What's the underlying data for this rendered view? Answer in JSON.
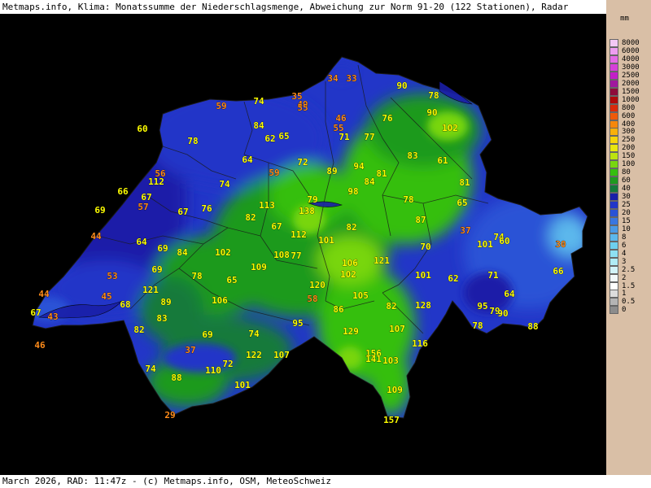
{
  "title": "Metmaps.info, Klima: Monatssumme der Niederschlagsmenge, Abweichung zur Norm 91-20 (122 Stationen), Radar",
  "footer": "March 2026, RAD: 11:47z - (c) Metmaps.info, OSM, MeteoSchweiz",
  "legend": {
    "unit": "mm",
    "classes": [
      {
        "label": "8000",
        "color": "#f3c8f4"
      },
      {
        "label": "6000",
        "color": "#ee9df0"
      },
      {
        "label": "4000",
        "color": "#e46ae6"
      },
      {
        "label": "3000",
        "color": "#d63fd9"
      },
      {
        "label": "2500",
        "color": "#c21fc7"
      },
      {
        "label": "2000",
        "color": "#a0189e"
      },
      {
        "label": "1500",
        "color": "#8e0c3a"
      },
      {
        "label": "1000",
        "color": "#b00a0a"
      },
      {
        "label": "800",
        "color": "#d92a0a"
      },
      {
        "label": "600",
        "color": "#ee5a0a"
      },
      {
        "label": "400",
        "color": "#f6870a"
      },
      {
        "label": "300",
        "color": "#f9b00a"
      },
      {
        "label": "250",
        "color": "#f6d40a"
      },
      {
        "label": "200",
        "color": "#e8e60f"
      },
      {
        "label": "150",
        "color": "#bde30f"
      },
      {
        "label": "100",
        "color": "#78d60f"
      },
      {
        "label": "80",
        "color": "#35bf0f"
      },
      {
        "label": "60",
        "color": "#1f9a1f"
      },
      {
        "label": "40",
        "color": "#147a3a"
      },
      {
        "label": "30",
        "color": "#1a1fa8"
      },
      {
        "label": "25",
        "color": "#2236c8"
      },
      {
        "label": "20",
        "color": "#2a52d6"
      },
      {
        "label": "15",
        "color": "#3a76e0"
      },
      {
        "label": "10",
        "color": "#4a9ae6"
      },
      {
        "label": "8",
        "color": "#5cb8ec"
      },
      {
        "label": "6",
        "color": "#6ed0ef"
      },
      {
        "label": "4",
        "color": "#8ee0f2"
      },
      {
        "label": "3",
        "color": "#b0ecf5"
      },
      {
        "label": "2.5",
        "color": "#d2f3f8"
      },
      {
        "label": "2",
        "color": "#f2f8fa"
      },
      {
        "label": "1.5",
        "color": "#ffffff"
      },
      {
        "label": "1",
        "color": "#dcdcdc"
      },
      {
        "label": "0.5",
        "color": "#b4b4b4"
      },
      {
        "label": "0",
        "color": "#8c8c8c"
      }
    ]
  },
  "stations": [
    {
      "v": "34",
      "c": "o"
    },
    {
      "v": "33",
      "c": "o"
    },
    {
      "v": "90",
      "c": "y"
    },
    {
      "v": "78",
      "c": "y"
    },
    {
      "v": "74",
      "c": "y"
    },
    {
      "v": "35",
      "c": "o"
    },
    {
      "v": "49",
      "c": "o"
    },
    {
      "v": "55",
      "c": "o"
    },
    {
      "v": "59",
      "c": "o"
    },
    {
      "v": "90",
      "c": "y"
    },
    {
      "v": "46",
      "c": "o"
    },
    {
      "v": "76",
      "c": "y"
    },
    {
      "v": "102",
      "c": "y"
    },
    {
      "v": "60",
      "c": "y"
    },
    {
      "v": "84",
      "c": "y"
    },
    {
      "v": "55",
      "c": "o"
    },
    {
      "v": "78",
      "c": "y"
    },
    {
      "v": "62",
      "c": "y"
    },
    {
      "v": "65",
      "c": "y"
    },
    {
      "v": "71",
      "c": "y"
    },
    {
      "v": "77",
      "c": "y"
    },
    {
      "v": "83",
      "c": "y"
    },
    {
      "v": "61",
      "c": "y"
    },
    {
      "v": "64",
      "c": "y"
    },
    {
      "v": "72",
      "c": "y"
    },
    {
      "v": "94",
      "c": "y"
    },
    {
      "v": "56",
      "c": "o"
    },
    {
      "v": "59",
      "c": "o"
    },
    {
      "v": "89",
      "c": "y"
    },
    {
      "v": "81",
      "c": "y"
    },
    {
      "v": "112",
      "c": "y"
    },
    {
      "v": "74",
      "c": "y"
    },
    {
      "v": "84",
      "c": "y"
    },
    {
      "v": "81",
      "c": "y"
    },
    {
      "v": "66",
      "c": "y"
    },
    {
      "v": "98",
      "c": "y"
    },
    {
      "v": "67",
      "c": "y"
    },
    {
      "v": "79",
      "c": "y"
    },
    {
      "v": "78",
      "c": "y"
    },
    {
      "v": "65",
      "c": "y"
    },
    {
      "v": "57",
      "c": "o"
    },
    {
      "v": "113",
      "c": "y"
    },
    {
      "v": "69",
      "c": "y"
    },
    {
      "v": "67",
      "c": "y"
    },
    {
      "v": "76",
      "c": "y"
    },
    {
      "v": "138",
      "c": "y"
    },
    {
      "v": "82",
      "c": "y"
    },
    {
      "v": "87",
      "c": "y"
    },
    {
      "v": "82",
      "c": "y"
    },
    {
      "v": "67",
      "c": "y"
    },
    {
      "v": "37",
      "c": "o"
    },
    {
      "v": "74",
      "c": "y"
    },
    {
      "v": "44",
      "c": "o"
    },
    {
      "v": "64",
      "c": "y"
    },
    {
      "v": "112",
      "c": "y"
    },
    {
      "v": "101",
      "c": "y"
    },
    {
      "v": "101",
      "c": "y"
    },
    {
      "v": "60",
      "c": "y"
    },
    {
      "v": "30",
      "c": "o"
    },
    {
      "v": "69",
      "c": "y"
    },
    {
      "v": "84",
      "c": "y"
    },
    {
      "v": "102",
      "c": "y"
    },
    {
      "v": "70",
      "c": "y"
    },
    {
      "v": "108",
      "c": "y"
    },
    {
      "v": "77",
      "c": "y"
    },
    {
      "v": "106",
      "c": "y"
    },
    {
      "v": "121",
      "c": "y"
    },
    {
      "v": "69",
      "c": "y"
    },
    {
      "v": "109",
      "c": "y"
    },
    {
      "v": "102",
      "c": "y"
    },
    {
      "v": "66",
      "c": "y"
    },
    {
      "v": "53",
      "c": "o"
    },
    {
      "v": "78",
      "c": "y"
    },
    {
      "v": "101",
      "c": "y"
    },
    {
      "v": "71",
      "c": "y"
    },
    {
      "v": "65",
      "c": "y"
    },
    {
      "v": "62",
      "c": "y"
    },
    {
      "v": "64",
      "c": "y"
    },
    {
      "v": "121",
      "c": "y"
    },
    {
      "v": "120",
      "c": "y"
    },
    {
      "v": "44",
      "c": "o"
    },
    {
      "v": "45",
      "c": "o"
    },
    {
      "v": "105",
      "c": "y"
    },
    {
      "v": "68",
      "c": "y"
    },
    {
      "v": "106",
      "c": "y"
    },
    {
      "v": "58",
      "c": "o"
    },
    {
      "v": "89",
      "c": "y"
    },
    {
      "v": "82",
      "c": "y"
    },
    {
      "v": "128",
      "c": "y"
    },
    {
      "v": "95",
      "c": "y"
    },
    {
      "v": "79",
      "c": "y"
    },
    {
      "v": "90",
      "c": "y"
    },
    {
      "v": "67",
      "c": "y"
    },
    {
      "v": "43",
      "c": "o"
    },
    {
      "v": "86",
      "c": "y"
    },
    {
      "v": "83",
      "c": "y"
    },
    {
      "v": "95",
      "c": "y"
    },
    {
      "v": "78",
      "c": "y"
    },
    {
      "v": "88",
      "c": "y"
    },
    {
      "v": "82",
      "c": "y"
    },
    {
      "v": "69",
      "c": "y"
    },
    {
      "v": "74",
      "c": "y"
    },
    {
      "v": "129",
      "c": "y"
    },
    {
      "v": "107",
      "c": "y"
    },
    {
      "v": "46",
      "c": "o"
    },
    {
      "v": "116",
      "c": "y"
    },
    {
      "v": "37",
      "c": "o"
    },
    {
      "v": "122",
      "c": "y"
    },
    {
      "v": "107",
      "c": "y"
    },
    {
      "v": "156",
      "c": "y"
    },
    {
      "v": "72",
      "c": "y"
    },
    {
      "v": "141",
      "c": "y"
    },
    {
      "v": "103",
      "c": "y"
    },
    {
      "v": "74",
      "c": "y"
    },
    {
      "v": "110",
      "c": "y"
    },
    {
      "v": "88",
      "c": "y"
    },
    {
      "v": "101",
      "c": "y"
    },
    {
      "v": "109",
      "c": "y"
    },
    {
      "v": "29",
      "c": "o"
    },
    {
      "v": "157",
      "c": "y"
    }
  ]
}
